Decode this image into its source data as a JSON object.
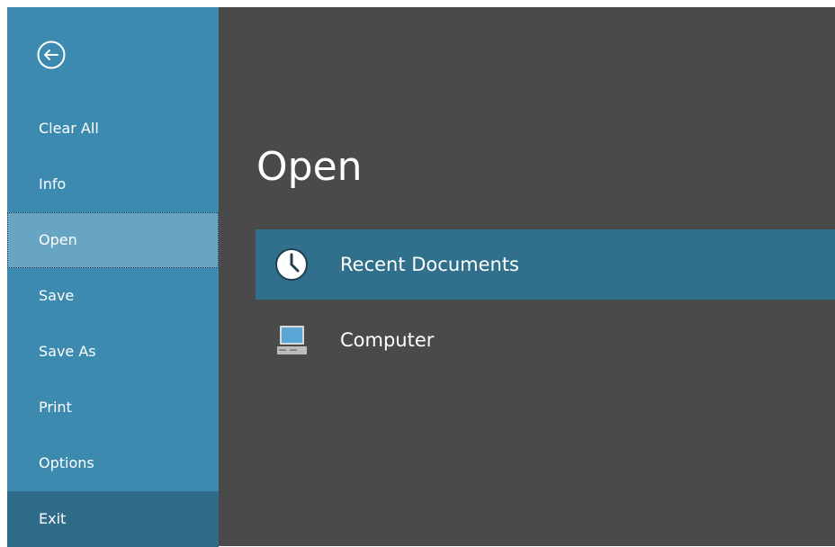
{
  "sidebar": {
    "back_icon": "back-arrow-circle-icon",
    "items": [
      {
        "label": "Clear All"
      },
      {
        "label": "Info"
      },
      {
        "label": "Open"
      },
      {
        "label": "Save"
      },
      {
        "label": "Save As"
      },
      {
        "label": "Print"
      },
      {
        "label": "Options"
      },
      {
        "label": "Exit"
      }
    ],
    "selected": "Open"
  },
  "main": {
    "title": "Open",
    "places": [
      {
        "label": "Recent Documents",
        "icon": "clock-icon",
        "selected": true
      },
      {
        "label": "Computer",
        "icon": "computer-icon",
        "selected": false
      }
    ]
  },
  "colors": {
    "sidebar_bg": "#3c8ab0",
    "sidebar_selected": "#67a5c3",
    "sidebar_exit": "#2f6c8a",
    "content_bg": "#4a4a4a",
    "place_selected": "#31708c",
    "text": "#ffffff"
  }
}
